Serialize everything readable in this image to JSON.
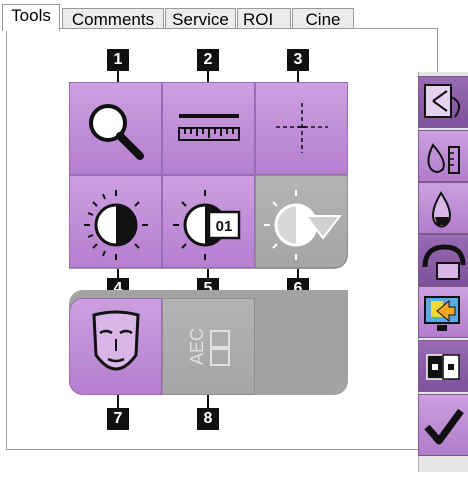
{
  "tabs": [
    "Tools",
    "Comments",
    "Service",
    "ROI",
    "Cine"
  ],
  "active_tab": "Tools",
  "numbers": [
    "1",
    "2",
    "3",
    "4",
    "5",
    "6",
    "7",
    "8"
  ],
  "tools": [
    {
      "icon": "magnifier-icon",
      "enabled": true
    },
    {
      "icon": "ruler-icon",
      "enabled": true
    },
    {
      "icon": "crosshair-icon",
      "enabled": true
    },
    {
      "icon": "window-level-icon",
      "enabled": true
    },
    {
      "icon": "window-level-presets-icon",
      "enabled": true,
      "text": "01"
    },
    {
      "icon": "window-level-dropdown-icon",
      "enabled": false
    },
    {
      "icon": "face-icon",
      "enabled": true
    },
    {
      "icon": "aec-icon",
      "enabled": false,
      "text": "AEC"
    }
  ],
  "sidebar": [
    "swap-views-icon",
    "dose-scale-icon",
    "drop-icon",
    "rotate-icon",
    "monitor-icon",
    "invert-icon",
    "accept-icon"
  ],
  "colors": {
    "active_purple": "#b57fd0",
    "disabled_gray": "#a5a5a5"
  }
}
